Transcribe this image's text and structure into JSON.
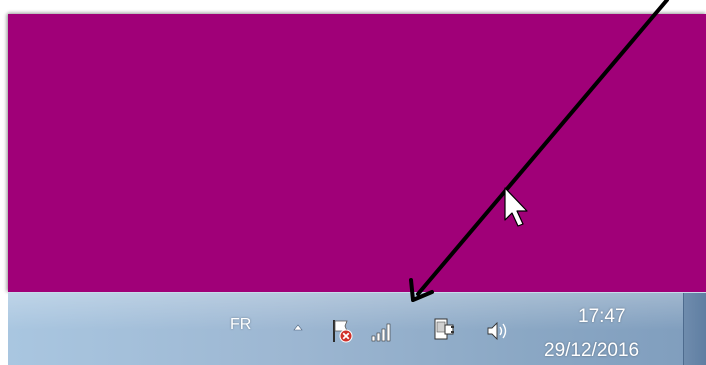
{
  "taskbar": {
    "language": "FR",
    "clock_time": "17:47",
    "clock_date": "29/12/2016"
  },
  "tray_icons": [
    "show-hidden-icons-arrow",
    "action-center-flag-error-icon",
    "network-signal-icon",
    "power-plug-icon",
    "volume-icon"
  ],
  "colors": {
    "desktop": "#a00078",
    "taskbar": "#9db7d2",
    "annotation_arrow": "#000000"
  }
}
